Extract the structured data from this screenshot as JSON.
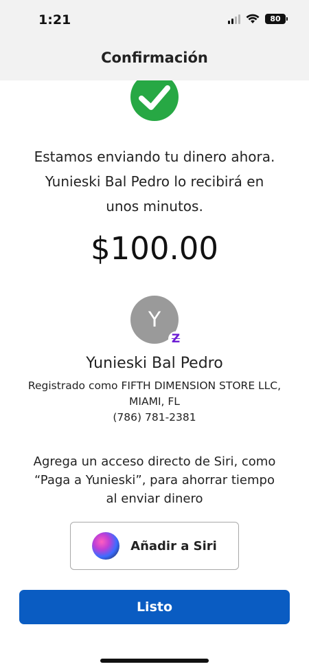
{
  "status_bar": {
    "time": "1:21",
    "battery": "80",
    "signal_icon": "cellular-signal-icon",
    "wifi_icon": "wifi-icon"
  },
  "header": {
    "title": "Confirmación"
  },
  "confirmation": {
    "icon": "checkmark-icon",
    "icon_color": "#27a844",
    "message": "Estamos enviando tu dinero ahora. Yunieski Bal Pedro lo recibirá en unos minutos.",
    "amount": "$100.00"
  },
  "recipient": {
    "initial": "Y",
    "badge": "Z",
    "badge_color": "#6d1ed4",
    "name": "Yunieski Bal Pedro",
    "registered": "Registrado como FIFTH DIMENSION STORE LLC, MIAMI, FL",
    "phone": "(786) 781-2381"
  },
  "siri": {
    "prompt": "Agrega un acceso directo de Siri, como “Paga a Yunieski”, para ahorrar tiempo al enviar dinero",
    "button_label": "Añadir a Siri",
    "icon": "siri-icon"
  },
  "actions": {
    "done_label": "Listo",
    "done_color": "#0a5cc2"
  }
}
